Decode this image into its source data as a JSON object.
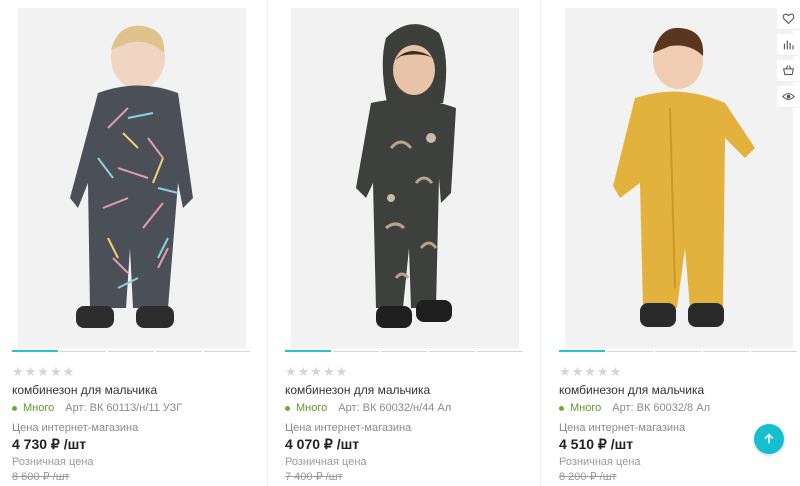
{
  "colors": {
    "accent": "#27c3d2",
    "in_stock": "#5a9a2a",
    "price": "#222222",
    "muted": "#8a8a8a"
  },
  "products": [
    {
      "rating": "★★★★★",
      "title": "комбинезон для мальчика",
      "stock": "Много",
      "sku": "Арт: ВК 60113/н/11 УЗГ",
      "price_label": "Цена интернет-магазина",
      "price": "4 730 ₽ /шт",
      "retail_label": "Розничная цена",
      "retail_price": "8 600 ₽ /шт",
      "image": "toddler-grey-snowsuit-photo"
    },
    {
      "rating": "★★★★★",
      "title": "комбинезон для мальчика",
      "stock": "Много",
      "sku": "Арт: ВК 60032/н/44 Ал",
      "price_label": "Цена интернет-магазина",
      "price": "4 070 ₽ /шт",
      "retail_label": "Розничная цена",
      "retail_price": "7 400 ₽ /шт",
      "image": "toddler-dark-dino-snowsuit-photo"
    },
    {
      "rating": "★★★★★",
      "title": "комбинезон для мальчика",
      "stock": "Много",
      "sku": "Арт: ВК 60032/8 Ал",
      "price_label": "Цена интернет-магазина",
      "price": "4 510 ₽ /шт",
      "retail_label": "Розничная цена",
      "retail_price": "8 200 ₽ /шт",
      "image": "toddler-mustard-snowsuit-photo"
    }
  ],
  "side_actions": [
    "heart-icon",
    "compare-chart-icon",
    "basket-icon",
    "eye-icon"
  ],
  "scroll_top_icon": "arrow-up-icon"
}
